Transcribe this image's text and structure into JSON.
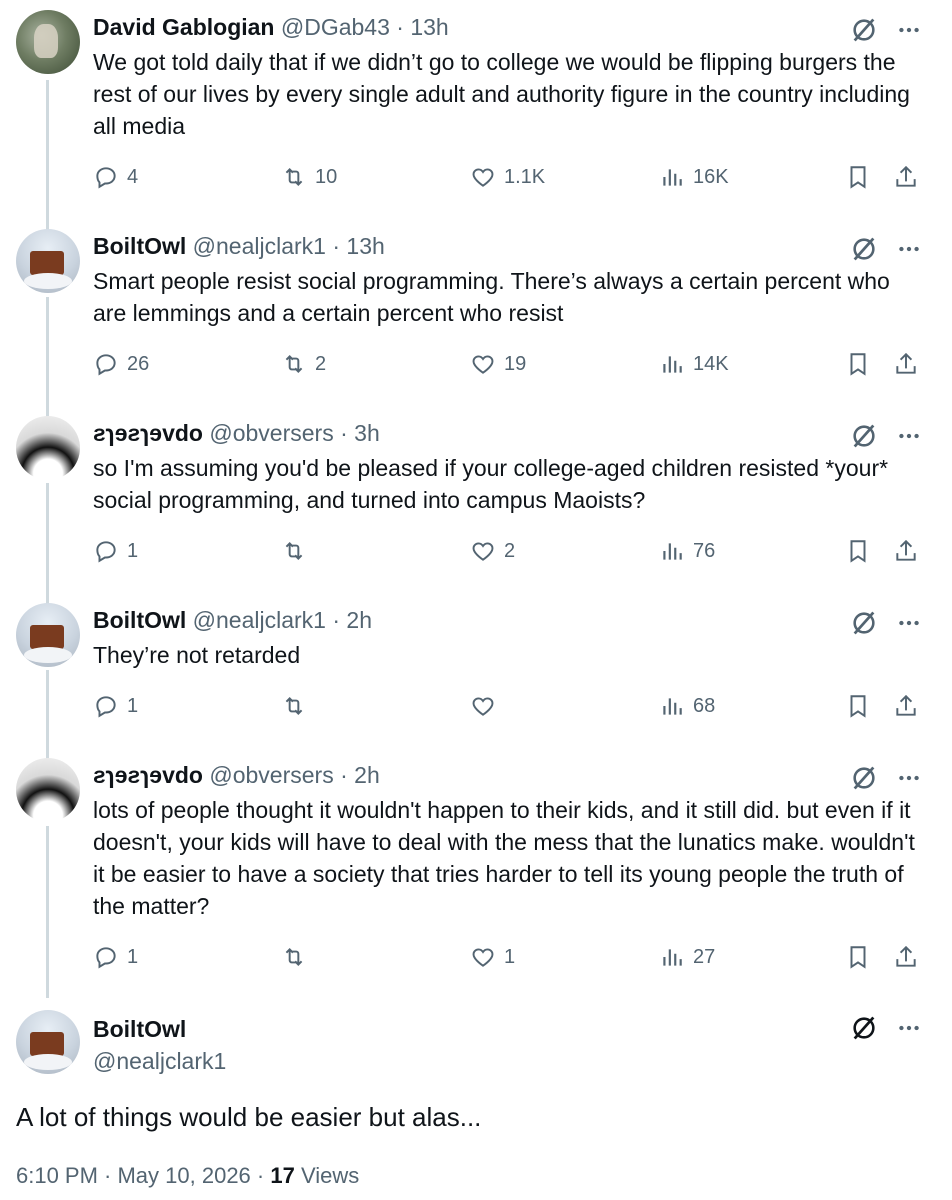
{
  "thread": [
    {
      "name": "David Gablogian",
      "handle": "@DGab43",
      "sep": "·",
      "time": "13h",
      "text": "We got told daily that if we didn’t go to college we would be flipping burgers the rest of our lives by every single adult and authority figure in the country including all media",
      "replies": "4",
      "reposts": "10",
      "likes": "1.1K",
      "views": "16K"
    },
    {
      "name": "BoiltOwl",
      "handle": "@nealjclark1",
      "sep": "·",
      "time": "13h",
      "text": "Smart people resist social programming. There’s always a certain percent who are lemmings and a certain percent who resist",
      "replies": "26",
      "reposts": "2",
      "likes": "19",
      "views": "14K"
    },
    {
      "name": "ƨɿɘƨɿɘvdo",
      "handle": "@obversers",
      "sep": "·",
      "time": "3h",
      "text": "so I'm assuming you'd be pleased if your college-aged children resisted *your* social programming, and turned into campus Maoists?",
      "replies": "1",
      "reposts": "",
      "likes": "2",
      "views": "76"
    },
    {
      "name": "BoiltOwl",
      "handle": "@nealjclark1",
      "sep": "·",
      "time": "2h",
      "text": "They’re not retarded",
      "replies": "1",
      "reposts": "",
      "likes": "",
      "views": "68"
    },
    {
      "name": "ƨɿɘƨɿɘvdo",
      "handle": "@obversers",
      "sep": "·",
      "time": "2h",
      "text": "lots of people thought it wouldn't happen to their kids, and it still did. but even if it doesn't, your kids will have to deal with the mess that the lunatics make. wouldn't it be easier to have a society that tries harder to tell its young people the truth of the matter?",
      "replies": "1",
      "reposts": "",
      "likes": "1",
      "views": "27"
    }
  ],
  "main": {
    "name": "BoiltOwl",
    "handle": "@nealjclark1",
    "text": "A lot of things would be easier but alas...",
    "timestamp": "6:10 PM · May 10, 2026 · ",
    "view_count": "17",
    "views_label": " Views"
  },
  "icons": {
    "reply": "reply-icon",
    "repost": "repost-icon",
    "like": "heart-icon",
    "views": "views-chart-icon",
    "bookmark": "bookmark-icon",
    "share": "share-icon",
    "grok": "grok-icon",
    "more": "more-icon"
  },
  "colors": {
    "text": "#0f1419",
    "muted": "#536471",
    "line": "#cfd9de"
  }
}
